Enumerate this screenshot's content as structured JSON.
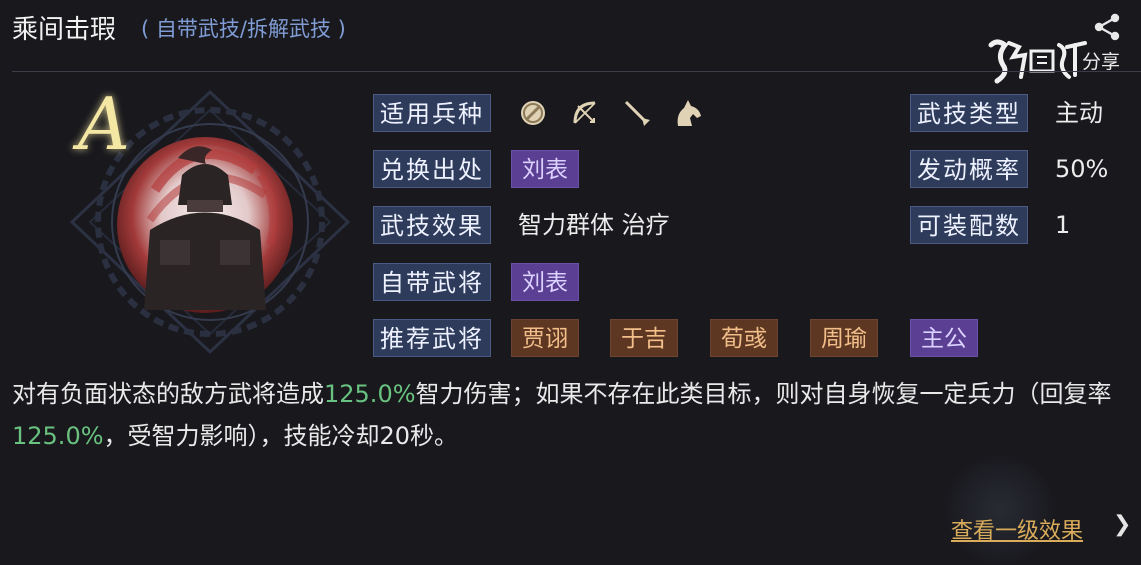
{
  "header": {
    "title": "乘间击瑕",
    "subtitle": "( 自带武技/拆解武技 )",
    "share_label": "分享",
    "share_icon": "share-icon",
    "watermark_text": "鸿图",
    "bg_color": "#18181d",
    "subtitle_color": "#7f9cd4"
  },
  "skill": {
    "grade": "A",
    "icon": "general-portrait-icon"
  },
  "attributes": {
    "unit_types_label": "适用兵种",
    "unit_types": [
      "shield-icon",
      "bow-icon",
      "spear-icon",
      "horse-icon"
    ],
    "exchange_source_label": "兑换出处",
    "exchange_source": "刘表",
    "effect_label": "武技效果",
    "effect_value": "智力群体 治疗",
    "native_general_label": "自带武将",
    "native_general": "刘表",
    "recommended_label": "推荐武将",
    "recommended": [
      "贾诩",
      "于吉",
      "荀彧",
      "周瑜",
      "主公"
    ],
    "skill_type_label": "武技类型",
    "skill_type": "主动",
    "trigger_rate_label": "发动概率",
    "trigger_rate": "50%",
    "equip_count_label": "可装配数",
    "equip_count": "1"
  },
  "description": {
    "part1": "对有负面状态的敌方武将造成",
    "value1": "125.0%",
    "part2": "智力伤害；如果不存在此类目标，则对自身恢复一定兵力（回复率",
    "value2": "125.0%",
    "part3": "，受智力影响），技能冷却20秒。",
    "highlight_color": "#69c27f"
  },
  "footer": {
    "view_level1_label": "查看一级效果",
    "arrow": "❯"
  },
  "colors": {
    "label_bg": "#2e3b5b",
    "tag_purple": "#5b3f93",
    "tag_brown": "#5e3722",
    "grade_color": "#f4e7a4",
    "link_color": "#d9ab5a"
  }
}
